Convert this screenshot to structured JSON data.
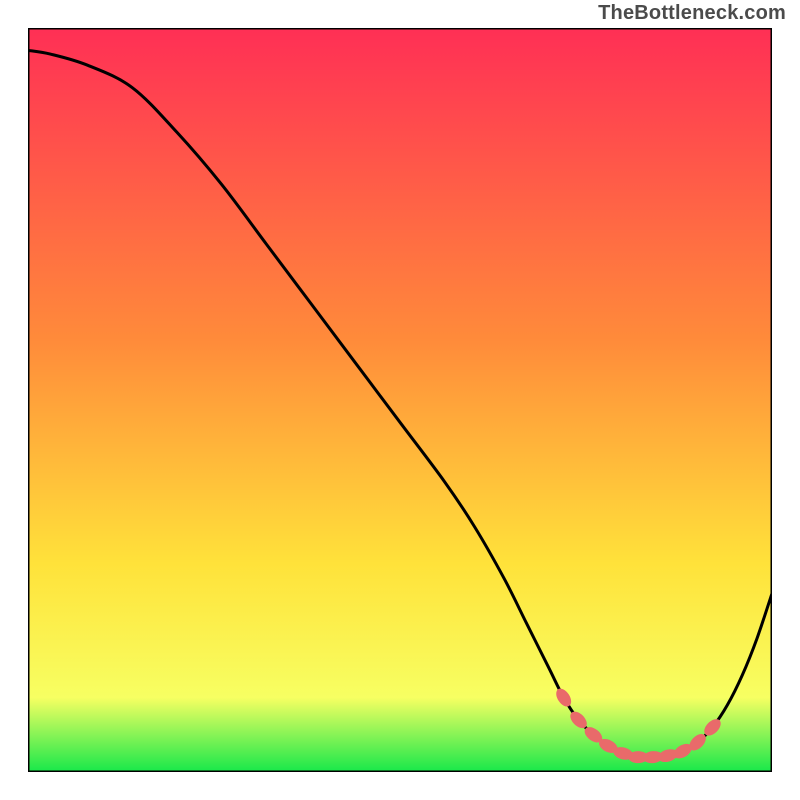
{
  "watermark": "TheBottleneck.com",
  "colors": {
    "gradient_top": "#ff2f55",
    "gradient_mid1": "#ff8b3a",
    "gradient_mid2": "#ffe23a",
    "gradient_mid3": "#f7ff62",
    "gradient_bottom": "#17e84a",
    "curve": "#000000",
    "marker": "#e96a6a",
    "frame": "#000000"
  },
  "chart_data": {
    "type": "line",
    "title": "",
    "xlabel": "",
    "ylabel": "",
    "xlim": [
      0,
      100
    ],
    "ylim": [
      0,
      100
    ],
    "x": [
      0,
      3,
      8,
      14,
      20,
      26,
      32,
      38,
      44,
      50,
      56,
      60,
      64,
      67,
      70,
      72,
      74,
      76,
      78,
      80,
      82,
      84,
      86,
      88,
      90,
      92,
      94,
      96,
      98,
      100
    ],
    "values": [
      97,
      96.5,
      95,
      92,
      86,
      79,
      71,
      63,
      55,
      47,
      39,
      33,
      26,
      20,
      14,
      10,
      7,
      5,
      3.5,
      2.5,
      2,
      2,
      2.2,
      2.8,
      4,
      6,
      9,
      13,
      18,
      24
    ],
    "series": [
      {
        "name": "bottleneck-curve",
        "x": [
          0,
          3,
          8,
          14,
          20,
          26,
          32,
          38,
          44,
          50,
          56,
          60,
          64,
          67,
          70,
          72,
          74,
          76,
          78,
          80,
          82,
          84,
          86,
          88,
          90,
          92,
          94,
          96,
          98,
          100
        ],
        "values": [
          97,
          96.5,
          95,
          92,
          86,
          79,
          71,
          63,
          55,
          47,
          39,
          33,
          26,
          20,
          14,
          10,
          7,
          5,
          3.5,
          2.5,
          2,
          2,
          2.2,
          2.8,
          4,
          6,
          9,
          13,
          18,
          24
        ]
      }
    ],
    "markers": {
      "name": "optimal-zone",
      "x": [
        72,
        74,
        76,
        78,
        80,
        82,
        84,
        86,
        88,
        90,
        92
      ],
      "values": [
        10,
        7,
        5,
        3.5,
        2.5,
        2,
        2,
        2.2,
        2.8,
        4,
        6
      ]
    }
  }
}
